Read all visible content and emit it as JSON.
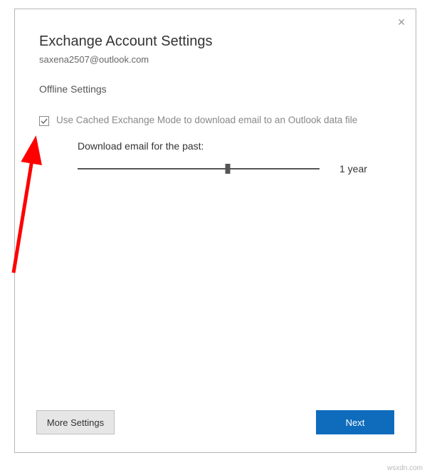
{
  "dialog": {
    "title": "Exchange Account Settings",
    "email": "saxena2507@outlook.com",
    "close_glyph": "✕"
  },
  "offline": {
    "section_label": "Offline Settings",
    "cached_mode_label": "Use Cached Exchange Mode to download email to an Outlook data file",
    "cached_mode_checked": true,
    "download_label": "Download email for the past:",
    "slider_value_label": "1 year"
  },
  "footer": {
    "more_settings_label": "More Settings",
    "next_label": "Next"
  },
  "colors": {
    "primary": "#0f6cbd",
    "annotation": "#ff0000"
  },
  "watermark": "wsxdn.com"
}
